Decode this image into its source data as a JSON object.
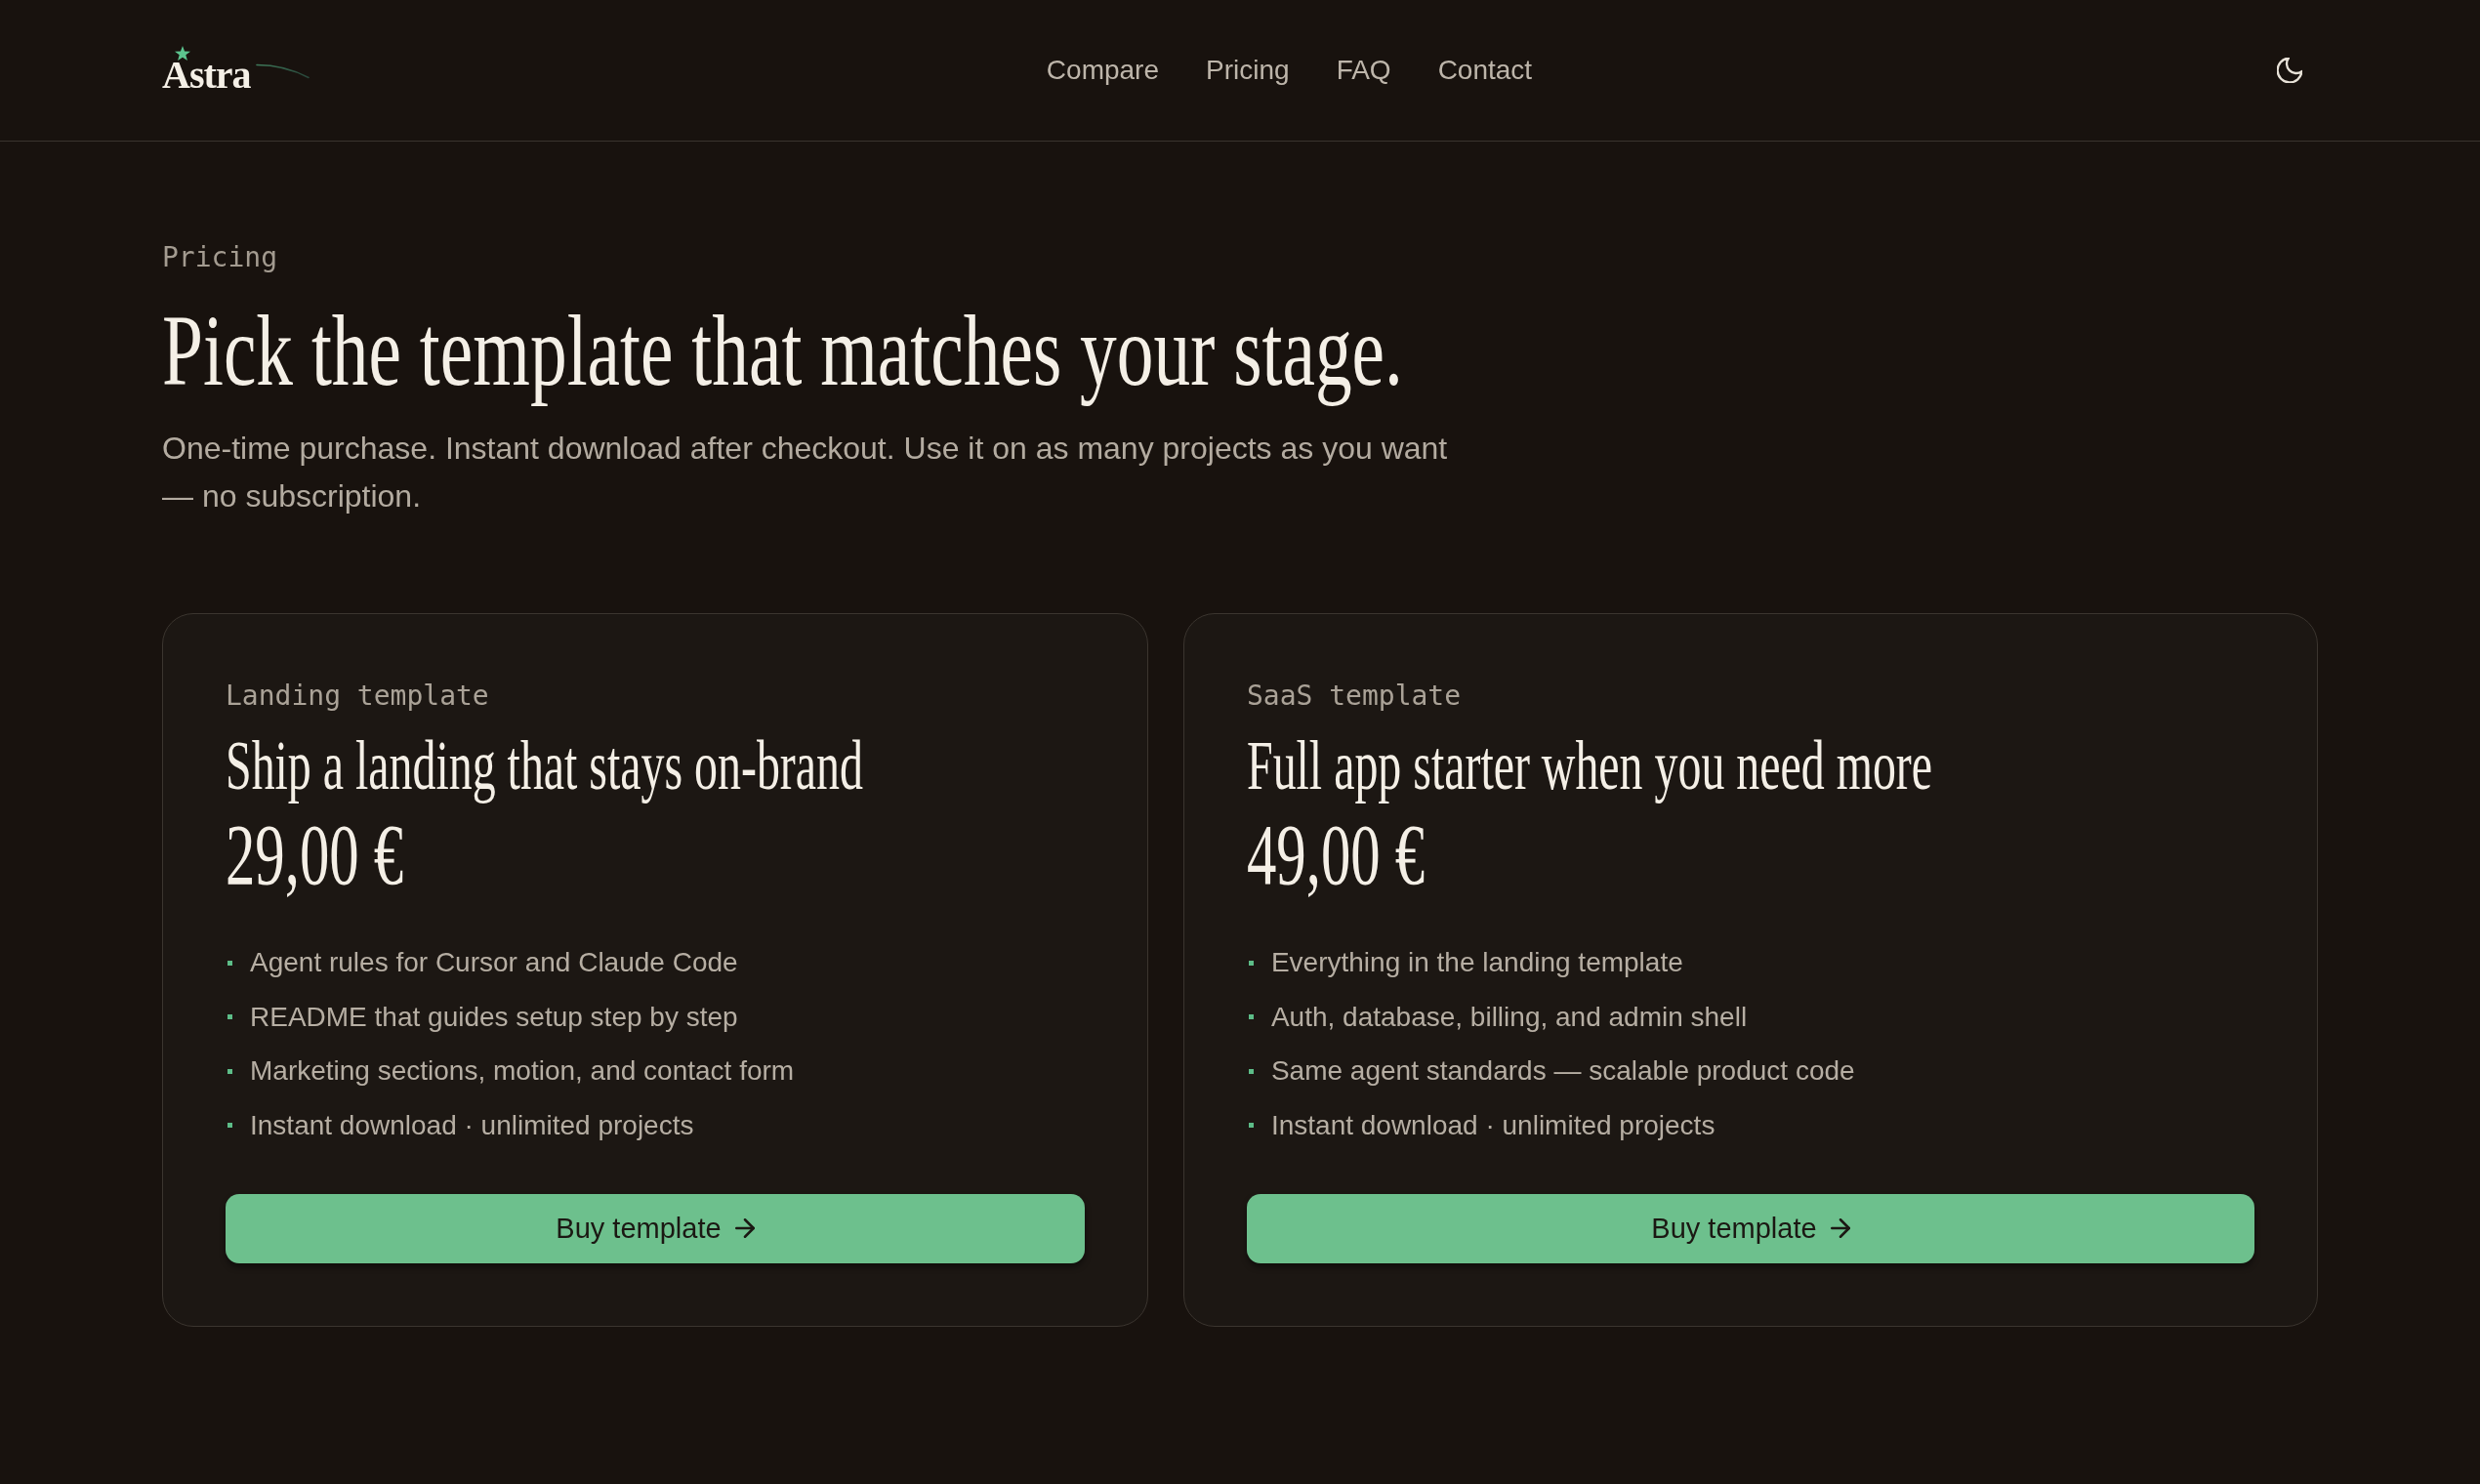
{
  "header": {
    "logo": "Astra",
    "nav": [
      "Compare",
      "Pricing",
      "FAQ",
      "Contact"
    ]
  },
  "hero": {
    "eyebrow": "Pricing",
    "title": "Pick the template that matches your stage.",
    "subtitle": "One-time purchase. Instant download after checkout. Use it on as many projects as you want — no subscription."
  },
  "plans": [
    {
      "label": "Landing template",
      "title": "Ship a landing that stays on-brand",
      "price": "29,00 €",
      "features": [
        "Agent rules for Cursor and Claude Code",
        "README that guides setup step by step",
        "Marketing sections, motion, and contact form",
        "Instant download · unlimited projects"
      ],
      "button": "Buy template"
    },
    {
      "label": "SaaS template",
      "title": "Full app starter when you need more",
      "price": "49,00 €",
      "features": [
        "Everything in the landing template",
        "Auth, database, billing, and admin shell",
        "Same agent standards — scalable product code",
        "Instant download · unlimited projects"
      ],
      "button": "Buy template"
    }
  ]
}
